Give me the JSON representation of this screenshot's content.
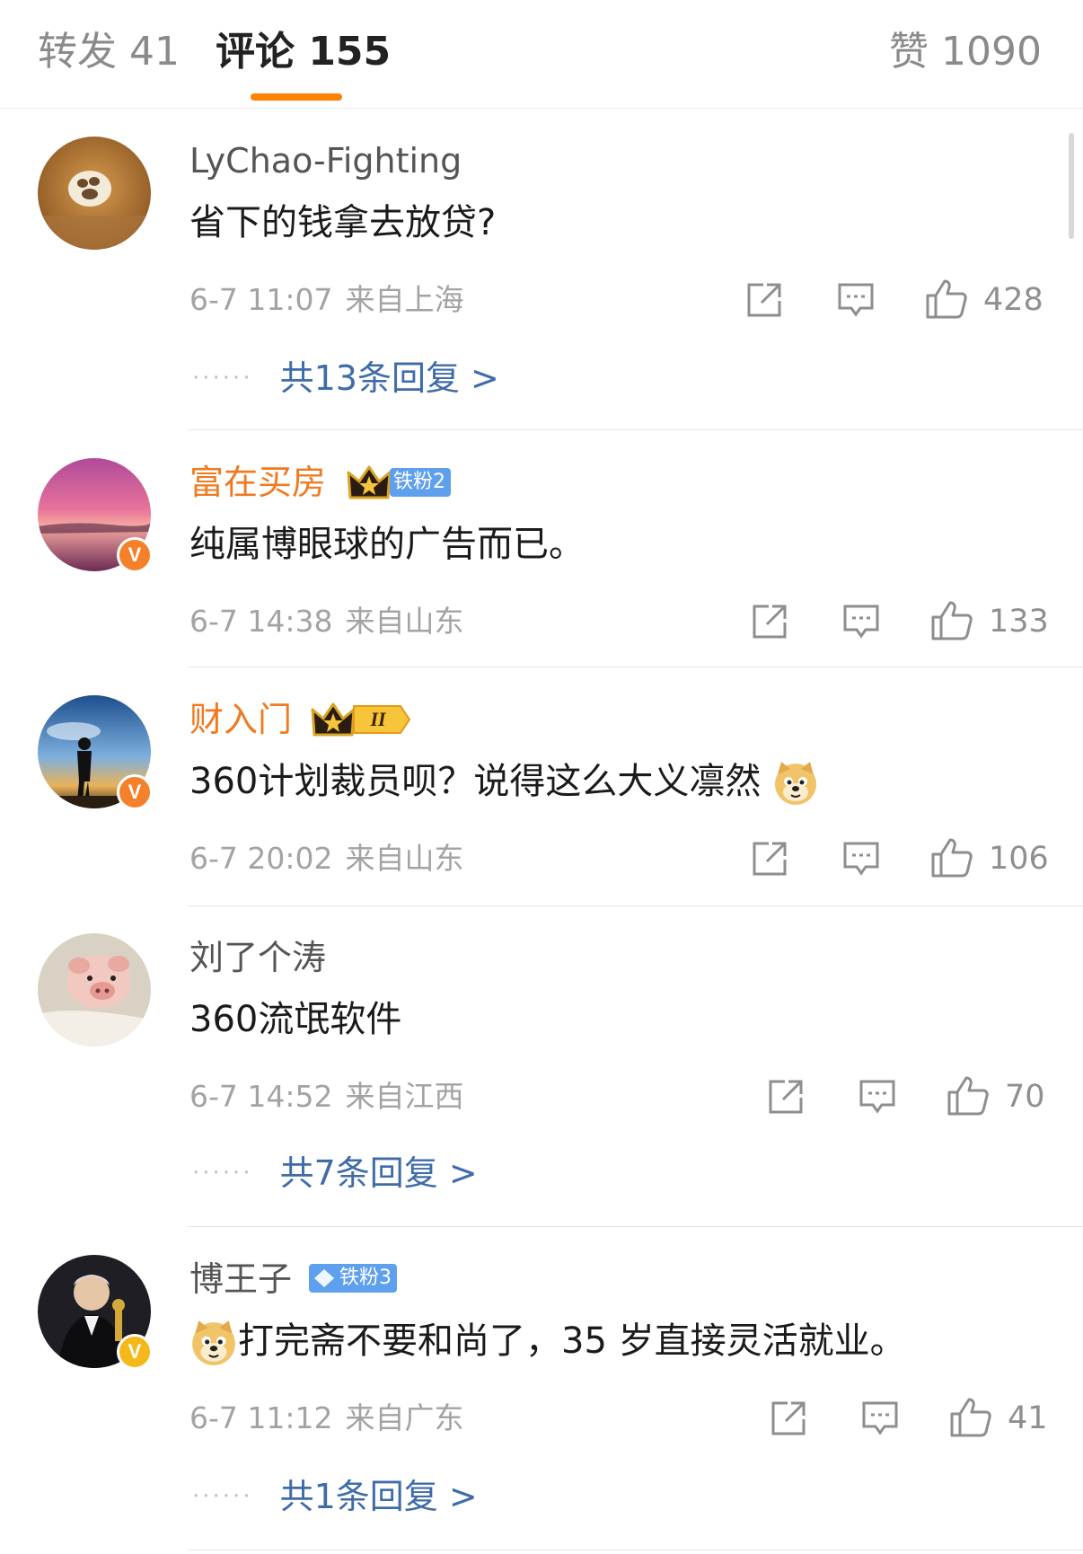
{
  "tabs": {
    "repost": "转发 41",
    "comments": "评论 155",
    "likes": "赞 1090"
  },
  "colors": {
    "accent": "#ff8200",
    "link": "#3f6ca8",
    "vip_name": "#f07a20",
    "fan_badge": "#5fa0ee"
  },
  "icons": {
    "share": "share-icon",
    "comment": "comment-bubble-icon",
    "like": "thumbs-up-icon",
    "crown": "crown-icon",
    "emoji": "doge-emoji"
  },
  "comments": [
    {
      "username": "LyChao-Fighting",
      "text": "省下的钱拿去放贷?",
      "date": "6-7 11:07",
      "location": "来自上海",
      "likes": "428",
      "replies_dots": "······",
      "replies_label": "共13条回复 >"
    },
    {
      "username": "富在买房",
      "fan_badge": "铁粉2",
      "text": "纯属博眼球的广告而已。",
      "date": "6-7 14:38",
      "location": "来自山东",
      "likes": "133",
      "verified_mark": "V"
    },
    {
      "username": "财入门",
      "level_badge": "II",
      "text": "360计划裁员呗？说得这么大义凛然",
      "date": "6-7 20:02",
      "location": "来自山东",
      "likes": "106",
      "verified_mark": "V"
    },
    {
      "username": "刘了个涛",
      "text": "360流氓软件",
      "date": "6-7 14:52",
      "location": "来自江西",
      "likes": "70",
      "replies_dots": "······",
      "replies_label": "共7条回复 >"
    },
    {
      "username": "博王子",
      "fan_badge": "铁粉3",
      "text": "打完斋不要和尚了，35 岁直接灵活就业。",
      "date": "6-7 11:12",
      "location": "来自广东",
      "likes": "41",
      "verified_mark": "V",
      "replies_dots": "······",
      "replies_label": "共1条回复 >"
    }
  ]
}
